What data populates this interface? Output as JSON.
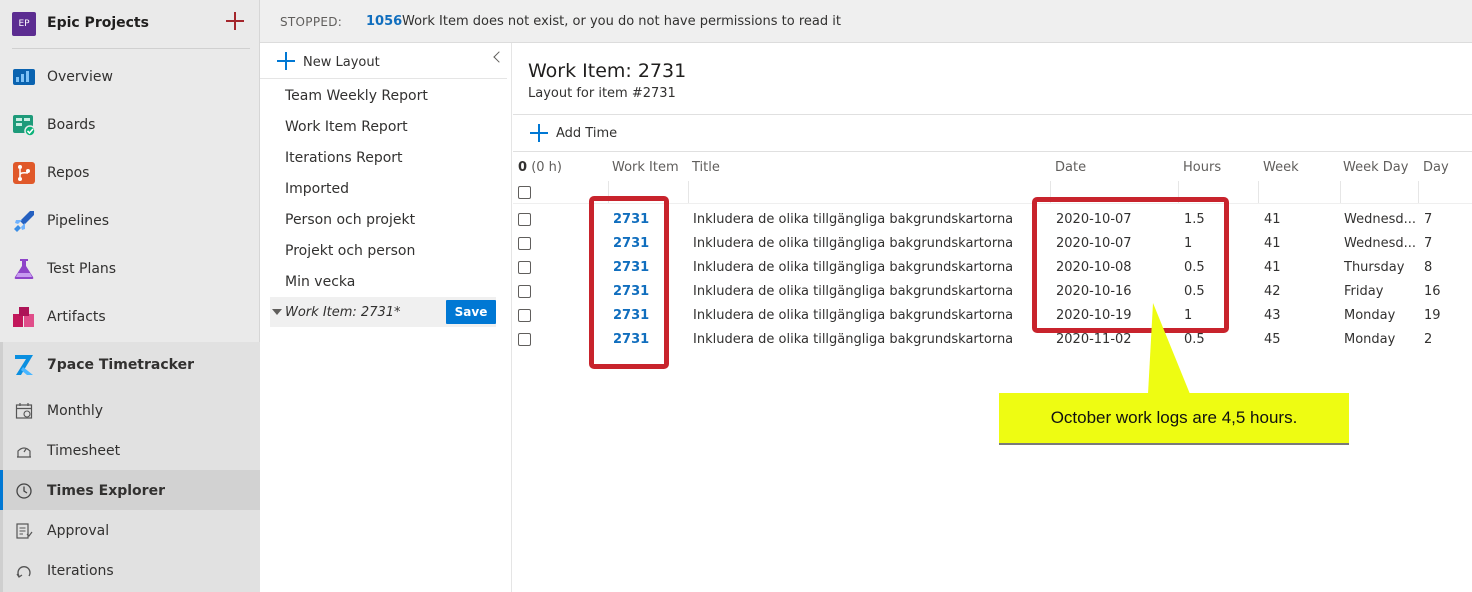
{
  "project": {
    "badge": "EP",
    "name": "Epic Projects"
  },
  "nav": [
    {
      "label": "Overview",
      "icon": "overview-icon"
    },
    {
      "label": "Boards",
      "icon": "boards-icon"
    },
    {
      "label": "Repos",
      "icon": "repos-icon"
    },
    {
      "label": "Pipelines",
      "icon": "pipelines-icon"
    },
    {
      "label": "Test Plans",
      "icon": "test-plans-icon"
    },
    {
      "label": "Artifacts",
      "icon": "artifacts-icon"
    }
  ],
  "timetracker": {
    "label": "7pace Timetracker",
    "items": [
      {
        "label": "Monthly",
        "icon": "calendar-icon"
      },
      {
        "label": "Timesheet",
        "icon": "timesheet-icon"
      },
      {
        "label": "Times Explorer",
        "icon": "clock-icon",
        "active": true
      },
      {
        "label": "Approval",
        "icon": "approval-icon"
      },
      {
        "label": "Iterations",
        "icon": "iterations-icon"
      }
    ]
  },
  "status": {
    "state": "STOPPED:",
    "code": "1056",
    "message": "Work Item does not exist, or you do not have permissions to read it"
  },
  "layouts": {
    "new_label": "New Layout",
    "items": [
      "Team Weekly Report",
      "Work Item Report",
      "Iterations Report",
      "Imported",
      "Person och projekt",
      "Projekt och person",
      "Min vecka"
    ],
    "active": "Work Item: 2731*",
    "save_label": "Save"
  },
  "main": {
    "title": "Work Item: 2731",
    "subtitle": "Layout for item #2731",
    "add_time": "Add Time",
    "summary_count": "0",
    "summary_hours": "(0 h)",
    "columns": {
      "work_item": "Work Item",
      "title": "Title",
      "date": "Date",
      "hours": "Hours",
      "week": "Week",
      "week_day": "Week Day",
      "day": "Day"
    },
    "rows": [
      {
        "work_item": "2731",
        "title": "Inkludera de olika tillgängliga bakgrundskartorna",
        "date": "2020-10-07",
        "hours": "1.5",
        "week": "41",
        "week_day": "Wednesd...",
        "day": "7"
      },
      {
        "work_item": "2731",
        "title": "Inkludera de olika tillgängliga bakgrundskartorna",
        "date": "2020-10-07",
        "hours": "1",
        "week": "41",
        "week_day": "Wednesd...",
        "day": "7"
      },
      {
        "work_item": "2731",
        "title": "Inkludera de olika tillgängliga bakgrundskartorna",
        "date": "2020-10-08",
        "hours": "0.5",
        "week": "41",
        "week_day": "Thursday",
        "day": "8"
      },
      {
        "work_item": "2731",
        "title": "Inkludera de olika tillgängliga bakgrundskartorna",
        "date": "2020-10-16",
        "hours": "0.5",
        "week": "42",
        "week_day": "Friday",
        "day": "16"
      },
      {
        "work_item": "2731",
        "title": "Inkludera de olika tillgängliga bakgrundskartorna",
        "date": "2020-10-19",
        "hours": "1",
        "week": "43",
        "week_day": "Monday",
        "day": "19"
      },
      {
        "work_item": "2731",
        "title": "Inkludera de olika tillgängliga bakgrundskartorna",
        "date": "2020-11-02",
        "hours": "0.5",
        "week": "45",
        "week_day": "Monday",
        "day": "2"
      }
    ]
  },
  "annotation": {
    "text": "October work logs are 4,5 hours.",
    "color": "#eefc12",
    "box_color": "#c8232c"
  },
  "colors": {
    "accent": "#0078d4",
    "link": "#106ebe"
  }
}
